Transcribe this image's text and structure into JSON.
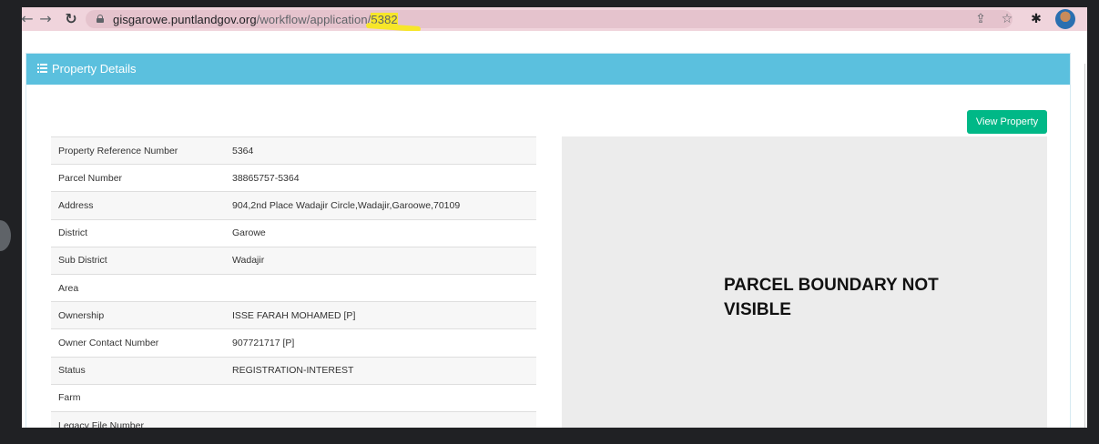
{
  "browser": {
    "url_host": "gisgarowe.puntlandgov.org",
    "url_path": "/workflow/application/",
    "url_highlight": "5382",
    "icons": {
      "back": "arrow-left",
      "forward": "arrow-right",
      "reload": "reload",
      "lock": "lock",
      "share": "share",
      "star": "star",
      "extensions": "puzzle",
      "profile": "avatar"
    }
  },
  "panel": {
    "title": "Property Details",
    "header_color": "#5bc0de"
  },
  "view_button": {
    "label": "View Property",
    "color": "#00b887"
  },
  "details": [
    {
      "label": "Property Reference Number",
      "value": "5364"
    },
    {
      "label": "Parcel Number",
      "value": "38865757-5364"
    },
    {
      "label": "Address",
      "value": "904,2nd Place Wadajir Circle,Wadajir,Garoowe,70109"
    },
    {
      "label": "District",
      "value": "Garowe"
    },
    {
      "label": "Sub District",
      "value": "Wadajir"
    },
    {
      "label": "Area",
      "value": ""
    },
    {
      "label": "Ownership",
      "value": "ISSE FARAH MOHAMED [P]"
    },
    {
      "label": "Owner Contact Number",
      "value": "907721717 [P]"
    },
    {
      "label": "Status",
      "value": "REGISTRATION-INTEREST"
    },
    {
      "label": "Farm",
      "value": ""
    },
    {
      "label": "Legacy File Number",
      "value": ""
    }
  ],
  "map": {
    "message": "PARCEL BOUNDARY NOT VISIBLE"
  }
}
